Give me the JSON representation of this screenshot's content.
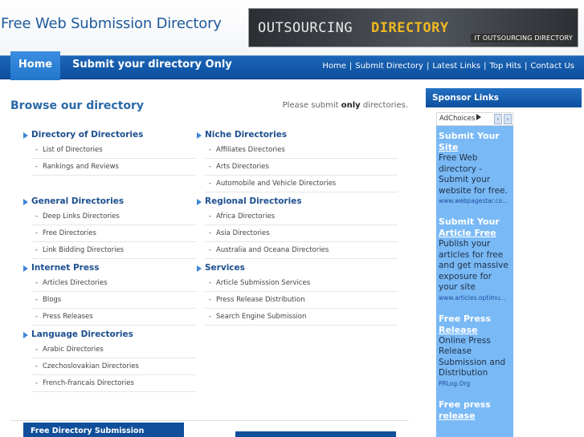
{
  "header": {
    "site_title": "Free Web Submission Directory",
    "banner_left": "OUTSOURCING",
    "banner_right": "DIRECTORY",
    "banner_sub": "IT OUTSOURCING DIRECTORY"
  },
  "nav": {
    "home": "Home",
    "submit_only": "Submit your directory Only",
    "links": [
      "Home",
      "Submit Directory",
      "Latest Links",
      "Top Hits",
      "Contact Us"
    ]
  },
  "main": {
    "heading": "Browse our directory",
    "please_prefix": "Please submit",
    "please_bold": "only",
    "please_suffix": "directories.",
    "categories": [
      {
        "title": "Directory of Directories",
        "items": [
          "List of Directories",
          "Rankings and Reviews"
        ]
      },
      {
        "title": "Niche Directories",
        "items": [
          "Affiliates Directories",
          "Arts Directories",
          "Automobile and Vehicle Directories"
        ]
      },
      {
        "title": "General Directories",
        "items": [
          "Deep Links Directories",
          "Free Directories",
          "Link Bidding Directories"
        ]
      },
      {
        "title": "Regional Directories",
        "items": [
          "Africa Directories",
          "Asia Directories",
          "Australia and Oceana Directories"
        ]
      },
      {
        "title": "Internet Press",
        "items": [
          "Articles Directories",
          "Blogs",
          "Press Releases"
        ]
      },
      {
        "title": "Services",
        "items": [
          "Article Submission Services",
          "Press Release Distribution",
          "Search Engine Submission"
        ]
      },
      {
        "title": "Language Directories",
        "items": [
          "Arabic Directories",
          "Czechoslovakian Directories",
          "French-francais Directories"
        ]
      }
    ],
    "footer_left": "Free Directory Submission"
  },
  "sidebar": {
    "heading": "Sponsor Links",
    "adchoices": "AdChoices",
    "ads": [
      {
        "title1": "Submit Your",
        "title2": "Site",
        "text": "Free Web directory - Submit your website for free.",
        "url": "www.webpagestar.co..."
      },
      {
        "title1": "Submit Your",
        "title2": "Article Free",
        "text": "Publish your articles for free and get massive exposure for your site",
        "url": "www.articles.optimu..."
      },
      {
        "title1": "Free Press",
        "title2": "Release",
        "text": "Online Press Release Submission and Distribution",
        "url": "PRLog.Org"
      },
      {
        "title1": "Free press",
        "title2": "release",
        "text": "",
        "url": ""
      }
    ]
  },
  "colors": {
    "nav_blue": "#0c4f9e",
    "link_blue": "#1c4f8f",
    "ad_bg": "#79b9f5",
    "banner_accent": "#f0b820"
  }
}
